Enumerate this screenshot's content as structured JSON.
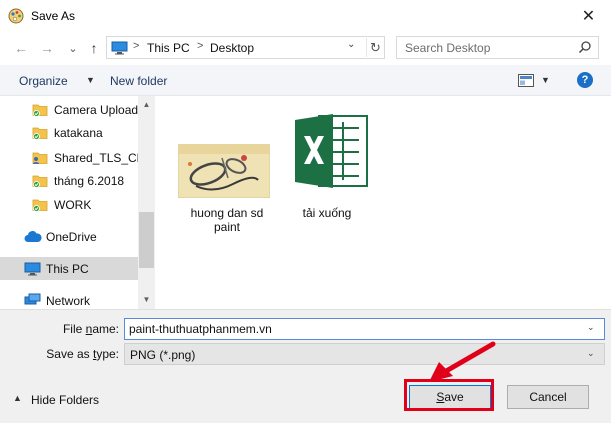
{
  "window": {
    "title": "Save As",
    "close_glyph": "✕"
  },
  "nav": {
    "back_glyph": "←",
    "forward_glyph": "→",
    "recent_glyph": "⌄",
    "up_glyph": "↑",
    "breadcrumb": [
      "This PC",
      "Desktop"
    ],
    "separator": ">",
    "dropdown_glyph": "⌄",
    "refresh_glyph": "↻",
    "search_placeholder": "Search Desktop"
  },
  "toolbar": {
    "organize_label": "Organize",
    "new_folder_label": "New folder",
    "help_label": "?",
    "dropdown_glyph": "▼"
  },
  "sidebar": {
    "items": [
      {
        "label": "Camera Uploads",
        "icon": "folder-sync-icon"
      },
      {
        "label": "katakana",
        "icon": "folder-sync-icon"
      },
      {
        "label": "Shared_TLS_Cha",
        "icon": "shared-folder-icon"
      },
      {
        "label": "tháng 6.2018",
        "icon": "folder-sync-icon"
      },
      {
        "label": "WORK",
        "icon": "folder-sync-icon"
      },
      {
        "label": "OneDrive",
        "icon": "cloud-icon"
      },
      {
        "label": "This PC",
        "icon": "computer-icon"
      },
      {
        "label": "Network",
        "icon": "network-icon"
      }
    ],
    "scroll_up_glyph": "▲",
    "scroll_down_glyph": "▼"
  },
  "files": [
    {
      "label": "huong dan sd paint",
      "icon": "image-thumbnail-icon"
    },
    {
      "label": "tải xuống",
      "icon": "excel-icon"
    }
  ],
  "form": {
    "filename_label_pre": "File ",
    "filename_label_key": "n",
    "filename_label_post": "ame:",
    "filename_value": "paint-thuthuatphanmem.vn",
    "savetype_label_pre": "Save as ",
    "savetype_label_key": "t",
    "savetype_label_post": "ype:",
    "savetype_value": "PNG (*.png)",
    "dropdown_glyph": "⌄"
  },
  "footer": {
    "hide_folders_label": "Hide Folders",
    "hide_folders_glyph": "▲",
    "save_label_key": "S",
    "save_label_rest": "ave",
    "cancel_label": "Cancel"
  },
  "colors": {
    "highlight": "#e0001a",
    "accent": "#0078d7",
    "excel_green": "#1d7044"
  }
}
